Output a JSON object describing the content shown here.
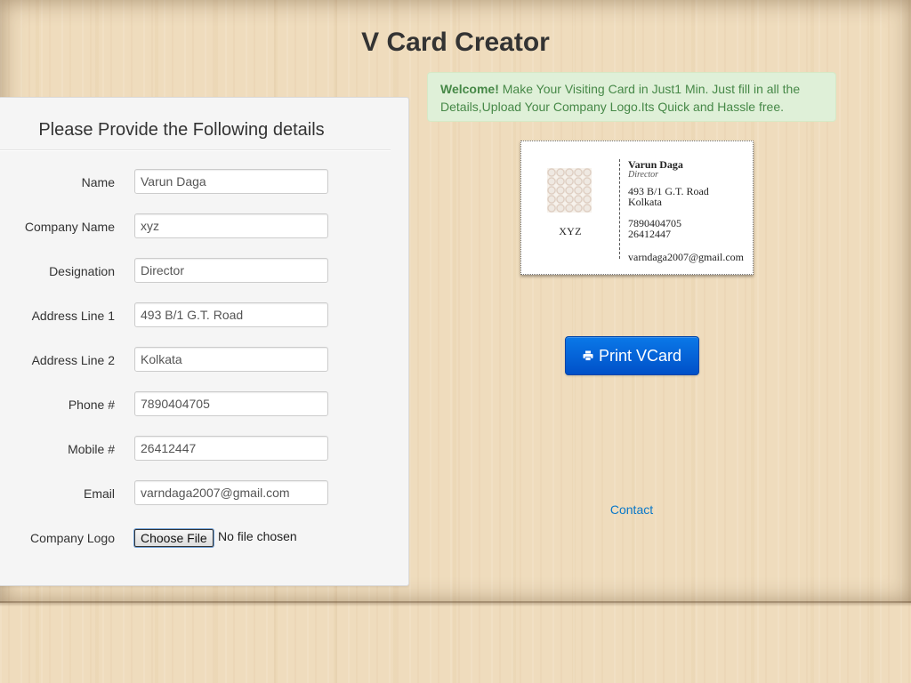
{
  "header": {
    "title": "V Card Creator"
  },
  "form": {
    "heading": "Please Provide the Following details",
    "fields": [
      {
        "label": "Name",
        "value": "Varun Daga"
      },
      {
        "label": "Company Name",
        "value": "xyz"
      },
      {
        "label": "Designation",
        "value": "Director"
      },
      {
        "label": "Address Line 1",
        "value": "493 B/1 G.T. Road"
      },
      {
        "label": "Address Line 2",
        "value": "Kolkata"
      },
      {
        "label": "Phone #",
        "value": "7890404705"
      },
      {
        "label": "Mobile #",
        "value": "26412447"
      },
      {
        "label": "Email",
        "value": "varndaga2007@gmail.com"
      }
    ],
    "logo": {
      "label": "Company Logo",
      "button_label": "Choose File",
      "status": "No file chosen"
    }
  },
  "alert": {
    "strong": "Welcome!",
    "text": " Make Your Visiting Card in Just1 Min. Just fill in all the Details,Upload Your Company Logo.Its Quick and Hassle free."
  },
  "card": {
    "company": "XYZ",
    "name": "Varun Daga",
    "designation": "Director",
    "address1": "493 B/1 G.T. Road",
    "address2": "Kolkata",
    "phone": "7890404705",
    "mobile": "26412447",
    "email": "varndaga2007@gmail.com"
  },
  "actions": {
    "print_label": "Print VCard",
    "contact_label": "Contact"
  },
  "colors": {
    "primary": "#0050c8",
    "alert_bg": "#dff0d8",
    "alert_text": "#468847",
    "link": "#0a78c8"
  }
}
